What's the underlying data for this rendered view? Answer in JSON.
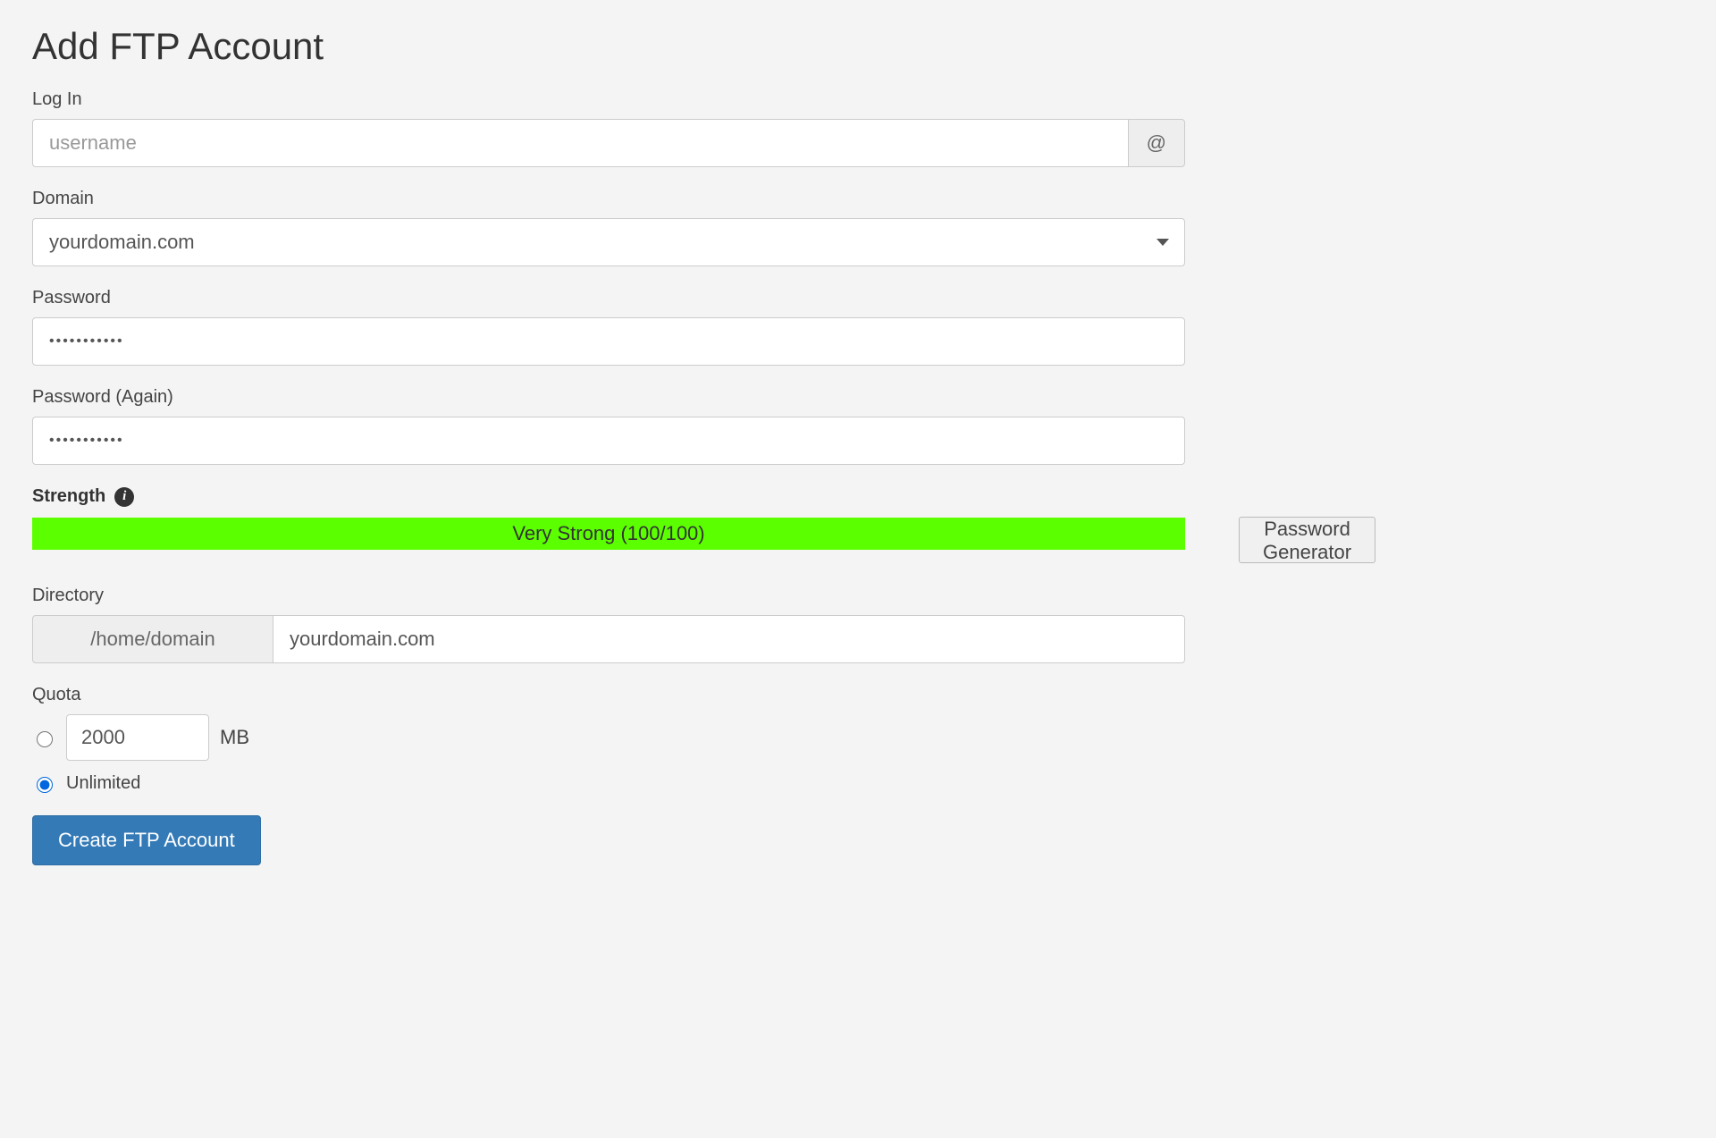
{
  "page": {
    "title": "Add FTP Account"
  },
  "login": {
    "label": "Log In",
    "placeholder": "username",
    "value": "",
    "addon": "@"
  },
  "domain": {
    "label": "Domain",
    "selected": "yourdomain.com"
  },
  "password": {
    "label": "Password",
    "value": "•••••••••••"
  },
  "password_again": {
    "label": "Password (Again)",
    "value": "•••••••••••"
  },
  "strength": {
    "label": "Strength",
    "text": "Very Strong (100/100)"
  },
  "password_generator": {
    "label": "Password Generator"
  },
  "directory": {
    "label": "Directory",
    "prefix": "/home/domain",
    "value": "yourdomain.com"
  },
  "quota": {
    "label": "Quota",
    "size_value": "2000",
    "unit": "MB",
    "unlimited_label": "Unlimited"
  },
  "submit": {
    "label": "Create FTP Account"
  }
}
